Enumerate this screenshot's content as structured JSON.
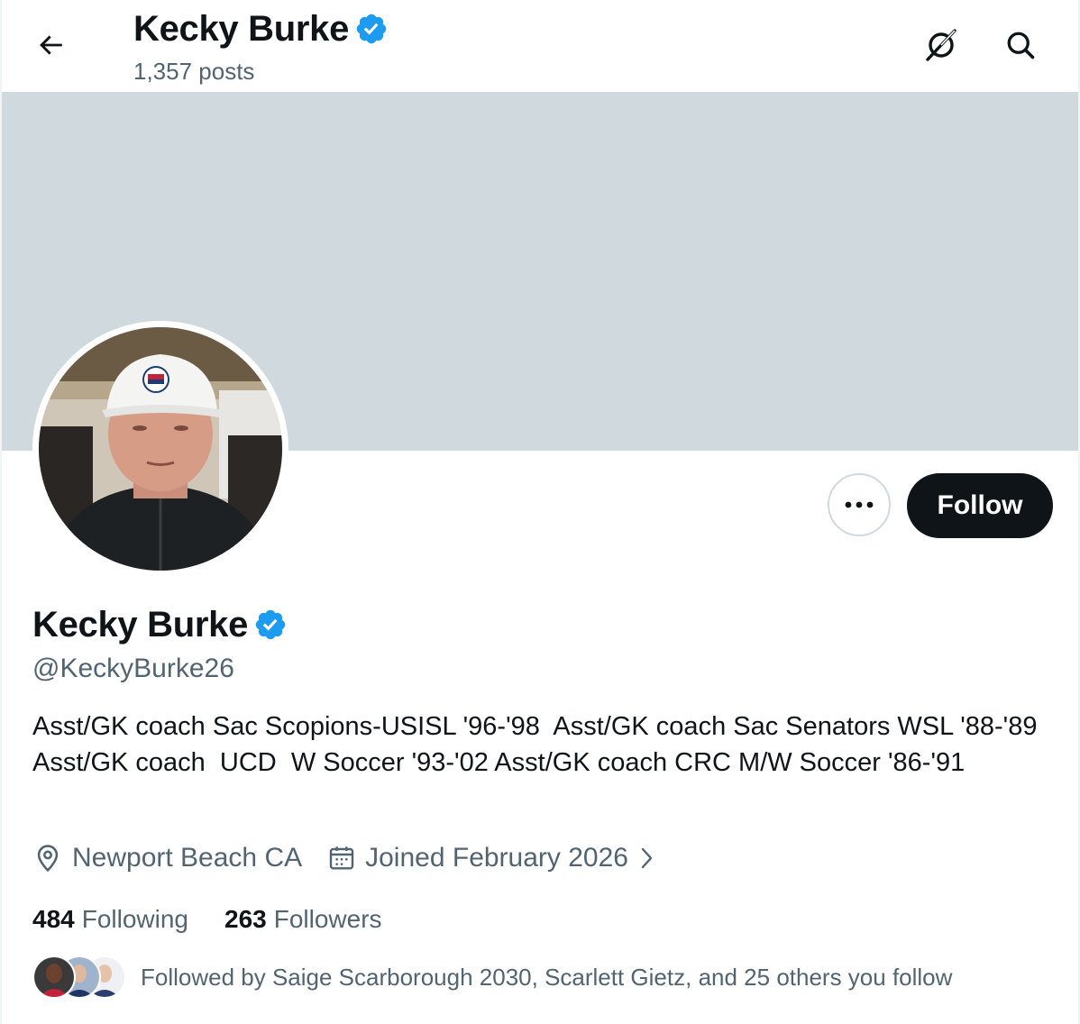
{
  "header": {
    "name": "Kecky Burke",
    "posts": "1,357 posts",
    "back_icon": "arrow-left-icon",
    "grok_icon": "grok-icon",
    "search_icon": "search-icon"
  },
  "profile": {
    "name": "Kecky Burke",
    "handle": "@KeckyBurke26",
    "verified": true,
    "verified_color": "#1d9bf0",
    "bio": "Asst/GK coach Sac Scopions-USISL '96-'98  Asst/GK coach Sac Senators WSL '88-'89  Asst/GK coach  UCD  W Soccer '93-'02 Asst/GK coach CRC M/W Soccer '86-'91",
    "location": "Newport Beach CA",
    "joined": "Joined February 2026",
    "following_count": "484",
    "following_label": "Following",
    "followers_count": "263",
    "followers_label": "Followers",
    "followed_by": "Followed by Saige Scarborough 2030, Scarlett Gietz, and 25 others you follow"
  },
  "actions": {
    "more_icon": "more-horizontal-icon",
    "follow_label": "Follow"
  },
  "colors": {
    "banner": "#cfd9de",
    "secondary_text": "#536471",
    "primary_text": "#0f1419",
    "follow_bg": "#0f1419"
  }
}
